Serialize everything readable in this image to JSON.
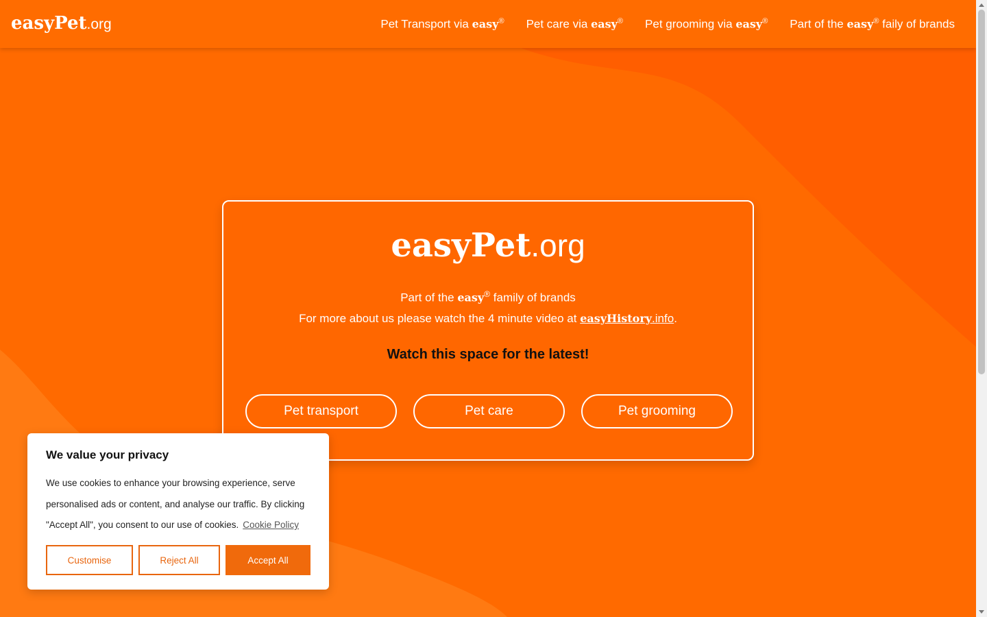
{
  "header": {
    "logo_bold": "easyPet",
    "logo_suffix": ".org",
    "nav": [
      {
        "text": "Pet Transport via ",
        "brand": "easy",
        "sup": "®",
        "after": ""
      },
      {
        "text": "Pet care via ",
        "brand": "easy",
        "sup": "®",
        "after": ""
      },
      {
        "text": "Pet grooming via ",
        "brand": "easy",
        "sup": "®",
        "after": ""
      },
      {
        "text": "Part of the ",
        "brand": "easy",
        "sup": "®",
        "after": " faily of brands"
      }
    ]
  },
  "card": {
    "logo_bold": "easyPet",
    "logo_suffix": ".org",
    "family_before": "Part of the ",
    "family_brand": "easy",
    "family_sup": "®",
    "family_after": " family of brands",
    "video_text": "For more about us please watch the 4 minute video at ",
    "video_link_bold": "easyHistory",
    "video_link_suffix": ".info",
    "video_end": ".",
    "watch": "Watch this space for the latest!",
    "buttons": [
      "Pet transport",
      "Pet care",
      "Pet grooming"
    ]
  },
  "cookie": {
    "title": "We value your privacy",
    "body": "We use cookies to enhance your browsing experience, serve personalised ads or content, and analyse our traffic. By clicking \"Accept All\", you consent to our use of cookies.",
    "policy_link": "Cookie Policy",
    "customise": "Customise",
    "reject": "Reject All",
    "accept": "Accept All"
  },
  "colors": {
    "primary": "#FF6A00",
    "accent_button": "#F06A0C",
    "bg_shape_dark": "#FF5C00",
    "bg_shape_light": "#FF7A10"
  }
}
